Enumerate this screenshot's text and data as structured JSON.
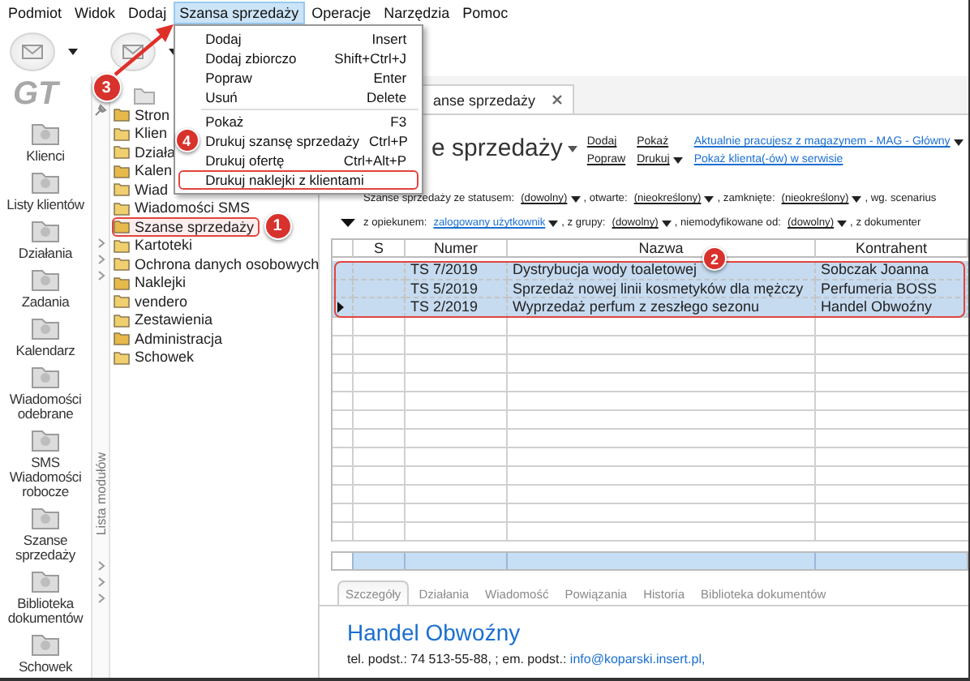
{
  "menu_bar": [
    {
      "label": "Podmiot",
      "selected": false
    },
    {
      "label": "Widok",
      "selected": false
    },
    {
      "label": "Dodaj",
      "selected": false
    },
    {
      "label": "Szansa sprzedaży",
      "selected": true,
      "callout": "3"
    },
    {
      "label": "Operacje",
      "selected": false
    },
    {
      "label": "Narzędzia",
      "selected": false
    },
    {
      "label": "Pomoc",
      "selected": false
    }
  ],
  "context_menu": {
    "groups": [
      {
        "items": [
          {
            "label": "Dodaj",
            "shortcut": "Insert",
            "outlined": false
          },
          {
            "label": "Dodaj zbiorczo",
            "shortcut": "Shift+Ctrl+J",
            "outlined": false
          },
          {
            "label": "Popraw",
            "shortcut": "Enter",
            "outlined": false
          },
          {
            "label": "Usuń",
            "shortcut": "Delete",
            "outlined": false
          }
        ]
      },
      {
        "items": [
          {
            "label": "Pokaż",
            "shortcut": "F3",
            "outlined": false
          },
          {
            "label": "Drukuj szansę sprzedaży",
            "shortcut": "Ctrl+P",
            "outlined": false,
            "callout": "4"
          },
          {
            "label": "Drukuj ofertę",
            "shortcut": "Ctrl+Alt+P",
            "outlined": false
          },
          {
            "label": "Drukuj naklejki z klientami",
            "outlined": true
          }
        ]
      }
    ]
  },
  "sidebar": {
    "logo": "GT",
    "items": [
      {
        "label": "Klienci"
      },
      {
        "label": "Listy klientów"
      },
      {
        "label": "Działania"
      },
      {
        "label": "Zadania"
      },
      {
        "label": "Kalendarz"
      },
      {
        "label": "Wiadomości odebrane"
      },
      {
        "label": "SMS Wiadomości robocze"
      },
      {
        "label": "Szanse sprzedaży"
      },
      {
        "label": "Biblioteka dokumentów"
      },
      {
        "label": "Schowek"
      }
    ]
  },
  "module_strip": {
    "label": "Lista modułów"
  },
  "module_tree": {
    "items": [
      {
        "label": "Stron",
        "outlined": false
      },
      {
        "label": "Klien",
        "outlined": false
      },
      {
        "label": "Działa",
        "outlined": false
      },
      {
        "label": "Kalen",
        "outlined": false
      },
      {
        "label": "Wiad",
        "outlined": false
      },
      {
        "label": "Wiadomości SMS",
        "outlined": false
      },
      {
        "label": "Szanse sprzedaży",
        "outlined": true,
        "callout": "1"
      },
      {
        "label": "Kartoteki",
        "outlined": false
      },
      {
        "label": "Ochrona danych osobowych",
        "outlined": false
      },
      {
        "label": "Naklejki",
        "outlined": false
      },
      {
        "label": "vendero",
        "outlined": false
      },
      {
        "label": "Zestawienia",
        "outlined": false
      },
      {
        "label": "Administracja",
        "outlined": false
      },
      {
        "label": "Schowek",
        "outlined": false
      }
    ]
  },
  "document_tab": {
    "label": "anse sprzedaży"
  },
  "heading": {
    "title": "e sprzedaży",
    "actions": [
      {
        "label": "Dodaj",
        "kind": "plain",
        "dropdown": false
      },
      {
        "label": "Popraw",
        "kind": "plain",
        "dropdown": false
      },
      {
        "label": "Pokaż",
        "kind": "plain",
        "dropdown": false
      },
      {
        "label": "Drukuj",
        "kind": "plain",
        "dropdown": true
      },
      {
        "label": "Aktualnie pracujesz z magazynem - MAG - Główny",
        "kind": "info",
        "dropdown": true
      },
      {
        "label": "Pokaż klienta(-ów) w serwisie",
        "kind": "info",
        "dropdown": false
      }
    ]
  },
  "filters": [
    {
      "collapse_toggle": false,
      "items": [
        {
          "label": "Szanse sprzedaży ze statusem:",
          "value": "(dowolny)",
          "kind": "plain"
        },
        {
          "label": ", otwarte:",
          "value": "(nieokreślony)",
          "kind": "plain"
        },
        {
          "label": ", zamknięte:",
          "value": "(nieokreślony)",
          "kind": "plain"
        },
        {
          "label": ", wg. scenarius"
        }
      ]
    },
    {
      "collapse_toggle": true,
      "items": [
        {
          "label": "z opiekunem:",
          "value": "zalogowany użytkownik",
          "kind": "link"
        },
        {
          "label": ", z grupy:",
          "value": "(dowolny)",
          "kind": "plain"
        },
        {
          "label": ", niemodyfikowane od:",
          "value": "(dowolny)",
          "kind": "plain"
        },
        {
          "label": ", z dokumenter"
        }
      ]
    }
  ],
  "table": {
    "columns": [
      {
        "label": "S"
      },
      {
        "label": "Numer"
      },
      {
        "label": "Nazwa",
        "callout": "2"
      },
      {
        "label": "Kontrahent"
      }
    ],
    "selection_outlined": true,
    "rows": [
      {
        "number": "TS 7/2019",
        "name": "Dystrybucja wody toaletowej",
        "contractor": "Sobczak Joanna",
        "selected": true,
        "current": false
      },
      {
        "number": "TS 5/2019",
        "name": "Sprzedaż nowej linii kosmetyków dla mężczy",
        "contractor": "Perfumeria BOSS",
        "selected": true,
        "current": false
      },
      {
        "number": "TS 2/2019",
        "name": "Wyprzedaż perfum z zeszłego sezonu",
        "contractor": "Handel Obwoźny",
        "selected": true,
        "current": true
      }
    ]
  },
  "detail_tabs": [
    {
      "label": "Szczegóły",
      "selected": true
    },
    {
      "label": "Działania",
      "selected": false
    },
    {
      "label": "Wiadomość",
      "selected": false
    },
    {
      "label": "Powiązania",
      "selected": false
    },
    {
      "label": "Historia",
      "selected": false
    },
    {
      "label": "Biblioteka dokumentów",
      "selected": false
    }
  ],
  "details": {
    "name": "Handel Obwoźny",
    "contact": "tel. podst.: 74 513-55-88, ; em. podst.:",
    "email": "info@koparski.insert.pl,"
  }
}
